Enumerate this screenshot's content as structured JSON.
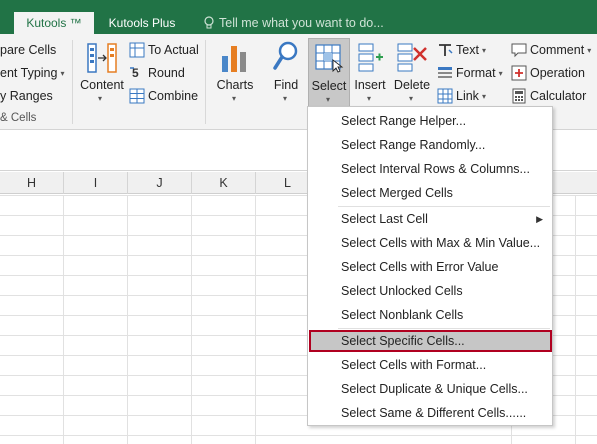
{
  "tabs": [
    {
      "label": "Kutools ™",
      "active": true
    },
    {
      "label": "Kutools Plus",
      "active": false
    }
  ],
  "tellme": {
    "placeholder": "Tell me what you want to do..."
  },
  "ribbon": {
    "left": {
      "compare_cells": "pare Cells",
      "content_typing": "ent Typing",
      "ranges": "y Ranges",
      "group_label": "& Cells"
    },
    "content_group": {
      "content": "Content",
      "to_actual": "To Actual",
      "round": "Round",
      "combine": "Combine"
    },
    "buttons": {
      "charts": "Charts",
      "find": "Find",
      "select": "Select",
      "insert": "Insert",
      "delete": "Delete"
    },
    "text_group": {
      "text": "Text",
      "format": "Format",
      "link": "Link"
    },
    "right_group": {
      "comment": "Comment",
      "operation": "Operation",
      "calculator": "Calculator"
    }
  },
  "columns": [
    "H",
    "I",
    "J",
    "K",
    "L"
  ],
  "menu": {
    "items": [
      {
        "label": "Select Range Helper...",
        "highlighted": false,
        "submenu": false
      },
      {
        "label": "Select Range Randomly...",
        "highlighted": false,
        "submenu": false
      },
      {
        "label": "Select Interval Rows & Columns...",
        "highlighted": false,
        "submenu": false
      },
      {
        "label": "Select Merged Cells",
        "highlighted": false,
        "submenu": false
      },
      {
        "label": "Select Last Cell",
        "highlighted": false,
        "submenu": true
      },
      {
        "label": "Select Cells with Max & Min Value...",
        "highlighted": false,
        "submenu": false
      },
      {
        "label": "Select Cells with Error Value",
        "highlighted": false,
        "submenu": false
      },
      {
        "label": "Select Unlocked Cells",
        "highlighted": false,
        "submenu": false
      },
      {
        "label": "Select Nonblank Cells",
        "highlighted": false,
        "submenu": false
      },
      {
        "label": "Select Specific Cells...",
        "highlighted": true,
        "submenu": false
      },
      {
        "label": "Select Cells with Format...",
        "highlighted": false,
        "submenu": false
      },
      {
        "label": "Select Duplicate & Unique Cells...",
        "highlighted": false,
        "submenu": false
      },
      {
        "label": "Select Same & Different Cells......",
        "highlighted": false,
        "submenu": false
      }
    ]
  },
  "colors": {
    "brand": "#217346",
    "highlight_border": "#b00020",
    "highlight_fill": "#c6c6c6"
  }
}
